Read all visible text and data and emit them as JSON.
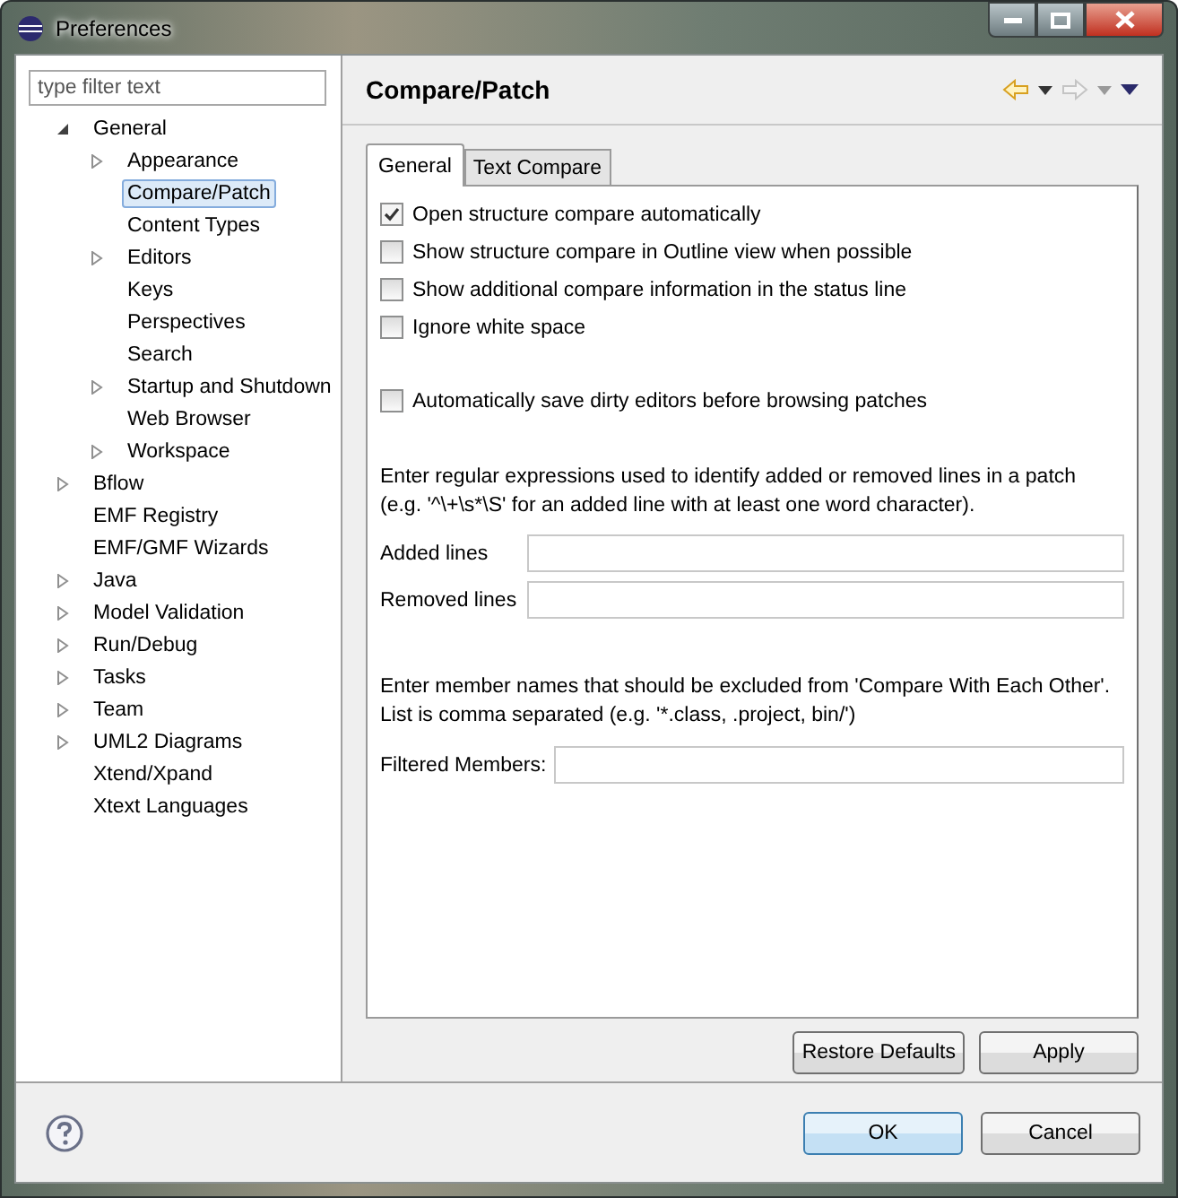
{
  "window": {
    "title": "Preferences"
  },
  "filter": {
    "placeholder": "type filter text"
  },
  "tree": [
    {
      "label": "General",
      "kind": "node",
      "expanded": true,
      "selected": false,
      "children": [
        {
          "label": "Appearance",
          "kind": "node",
          "expanded": false,
          "selected": false
        },
        {
          "label": "Compare/Patch",
          "kind": "leaf",
          "selected": true
        },
        {
          "label": "Content Types",
          "kind": "leaf",
          "selected": false
        },
        {
          "label": "Editors",
          "kind": "node",
          "expanded": false,
          "selected": false
        },
        {
          "label": "Keys",
          "kind": "leaf",
          "selected": false
        },
        {
          "label": "Perspectives",
          "kind": "leaf",
          "selected": false
        },
        {
          "label": "Search",
          "kind": "leaf",
          "selected": false
        },
        {
          "label": "Startup and Shutdown",
          "kind": "node",
          "expanded": false,
          "selected": false
        },
        {
          "label": "Web Browser",
          "kind": "leaf",
          "selected": false
        },
        {
          "label": "Workspace",
          "kind": "node",
          "expanded": false,
          "selected": false
        }
      ]
    },
    {
      "label": "Bflow",
      "kind": "node",
      "expanded": false,
      "selected": false
    },
    {
      "label": "EMF Registry",
      "kind": "leaf",
      "selected": false
    },
    {
      "label": "EMF/GMF Wizards",
      "kind": "leaf",
      "selected": false
    },
    {
      "label": "Java",
      "kind": "node",
      "expanded": false,
      "selected": false
    },
    {
      "label": "Model Validation",
      "kind": "node",
      "expanded": false,
      "selected": false
    },
    {
      "label": "Run/Debug",
      "kind": "node",
      "expanded": false,
      "selected": false
    },
    {
      "label": "Tasks",
      "kind": "node",
      "expanded": false,
      "selected": false
    },
    {
      "label": "Team",
      "kind": "node",
      "expanded": false,
      "selected": false
    },
    {
      "label": "UML2 Diagrams",
      "kind": "node",
      "expanded": false,
      "selected": false
    },
    {
      "label": "Xtend/Xpand",
      "kind": "leaf",
      "selected": false
    },
    {
      "label": "Xtext Languages",
      "kind": "leaf",
      "selected": false
    }
  ],
  "page": {
    "title": "Compare/Patch"
  },
  "tabs": [
    {
      "label": "General",
      "selected": true
    },
    {
      "label": "Text Compare",
      "selected": false
    }
  ],
  "options": [
    {
      "label": "Open structure compare automatically",
      "checked": true
    },
    {
      "label": "Show structure compare in Outline view when possible",
      "checked": false
    },
    {
      "label": "Show additional compare information in the status line",
      "checked": false
    },
    {
      "label": "Ignore white space",
      "checked": false
    }
  ],
  "patch_option": {
    "label": "Automatically save dirty editors before browsing patches",
    "checked": false
  },
  "patch_description": [
    "Enter regular expressions used to identify added or removed lines in a patch",
    "(e.g. '^\\+\\s*\\S' for an added line with at least one word character)."
  ],
  "patch_fields": [
    {
      "label": "Added lines"
    },
    {
      "label": "Removed lines"
    }
  ],
  "members_description": [
    "Enter member names that should be excluded from 'Compare With Each Other'.",
    "List is comma separated (e.g. '*.class, .project, bin/')"
  ],
  "members_field": {
    "label": "Filtered Members:"
  },
  "page_buttons": [
    "Restore Defaults",
    "Apply"
  ],
  "dialog_buttons": [
    {
      "label": "OK",
      "default": true
    },
    {
      "label": "Cancel",
      "default": false
    }
  ]
}
